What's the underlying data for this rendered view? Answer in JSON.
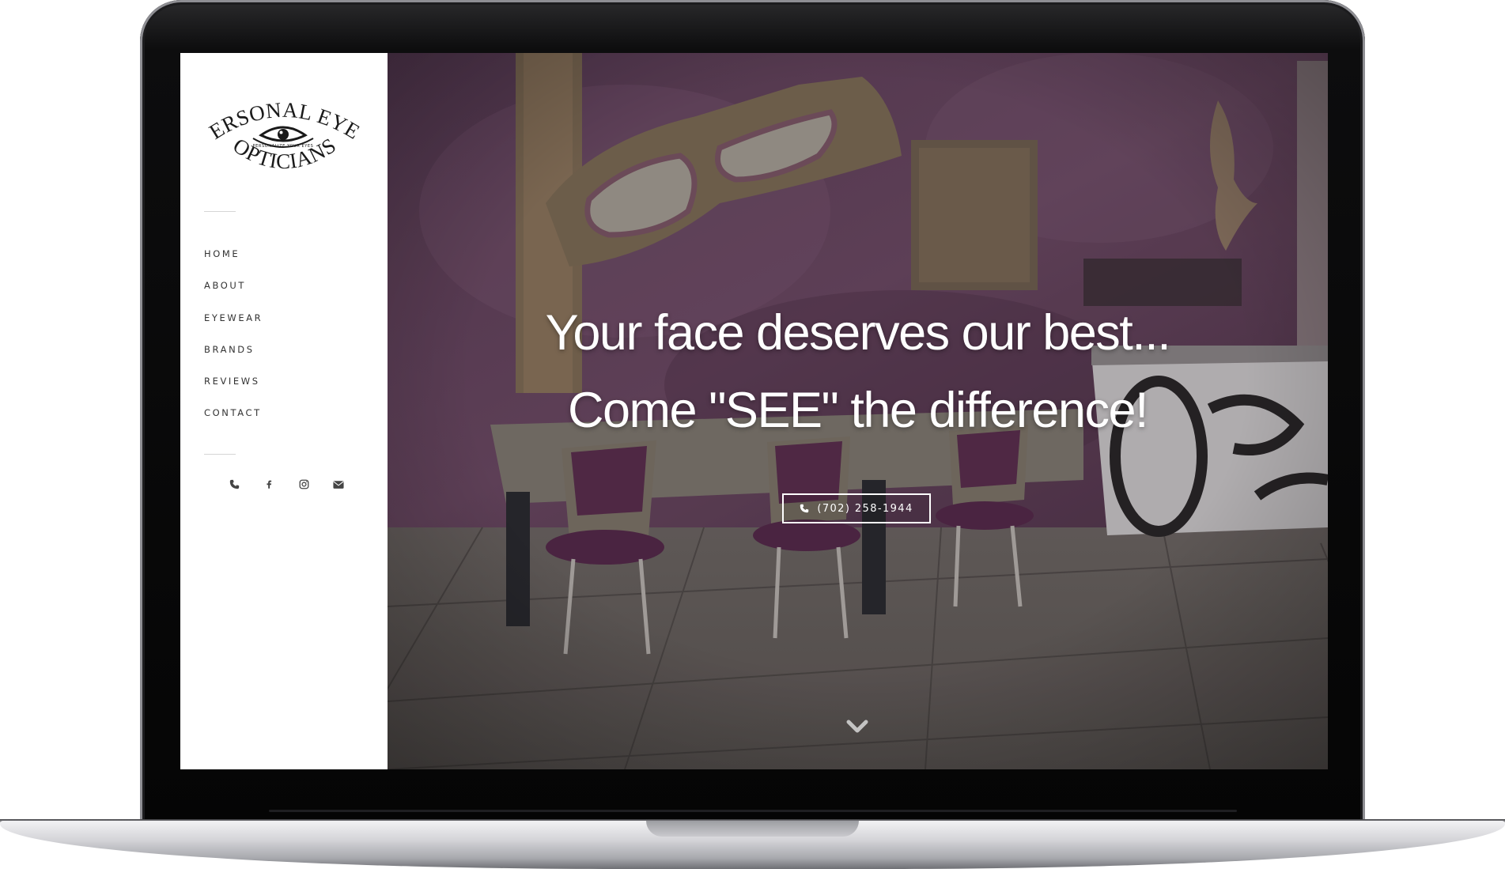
{
  "site": {
    "logo_text_top": "PERSONAL EYES",
    "logo_text_middle": "PERSONALIZE YOUR EYES",
    "logo_text_bottom": "OPTICIANS"
  },
  "nav": {
    "items": [
      {
        "label": "HOME"
      },
      {
        "label": "ABOUT"
      },
      {
        "label": "EYEWEAR"
      },
      {
        "label": "BRANDS"
      },
      {
        "label": "REVIEWS"
      },
      {
        "label": "CONTACT"
      }
    ]
  },
  "social": {
    "icons": [
      "phone-icon",
      "facebook-icon",
      "instagram-icon",
      "envelope-icon"
    ]
  },
  "hero": {
    "headline_1": "Your face deserves our best...",
    "headline_2": "Come \"SEE\" the difference!",
    "cta_label": "(702) 258-1944",
    "cta_icon": "phone-icon",
    "scroll_icon": "chevron-down-icon"
  },
  "colors": {
    "wall": "#5c3f58",
    "chair": "#5a2e4e",
    "floor": "#6f6a68",
    "text": "#ffffff",
    "nav_text": "#333333"
  }
}
